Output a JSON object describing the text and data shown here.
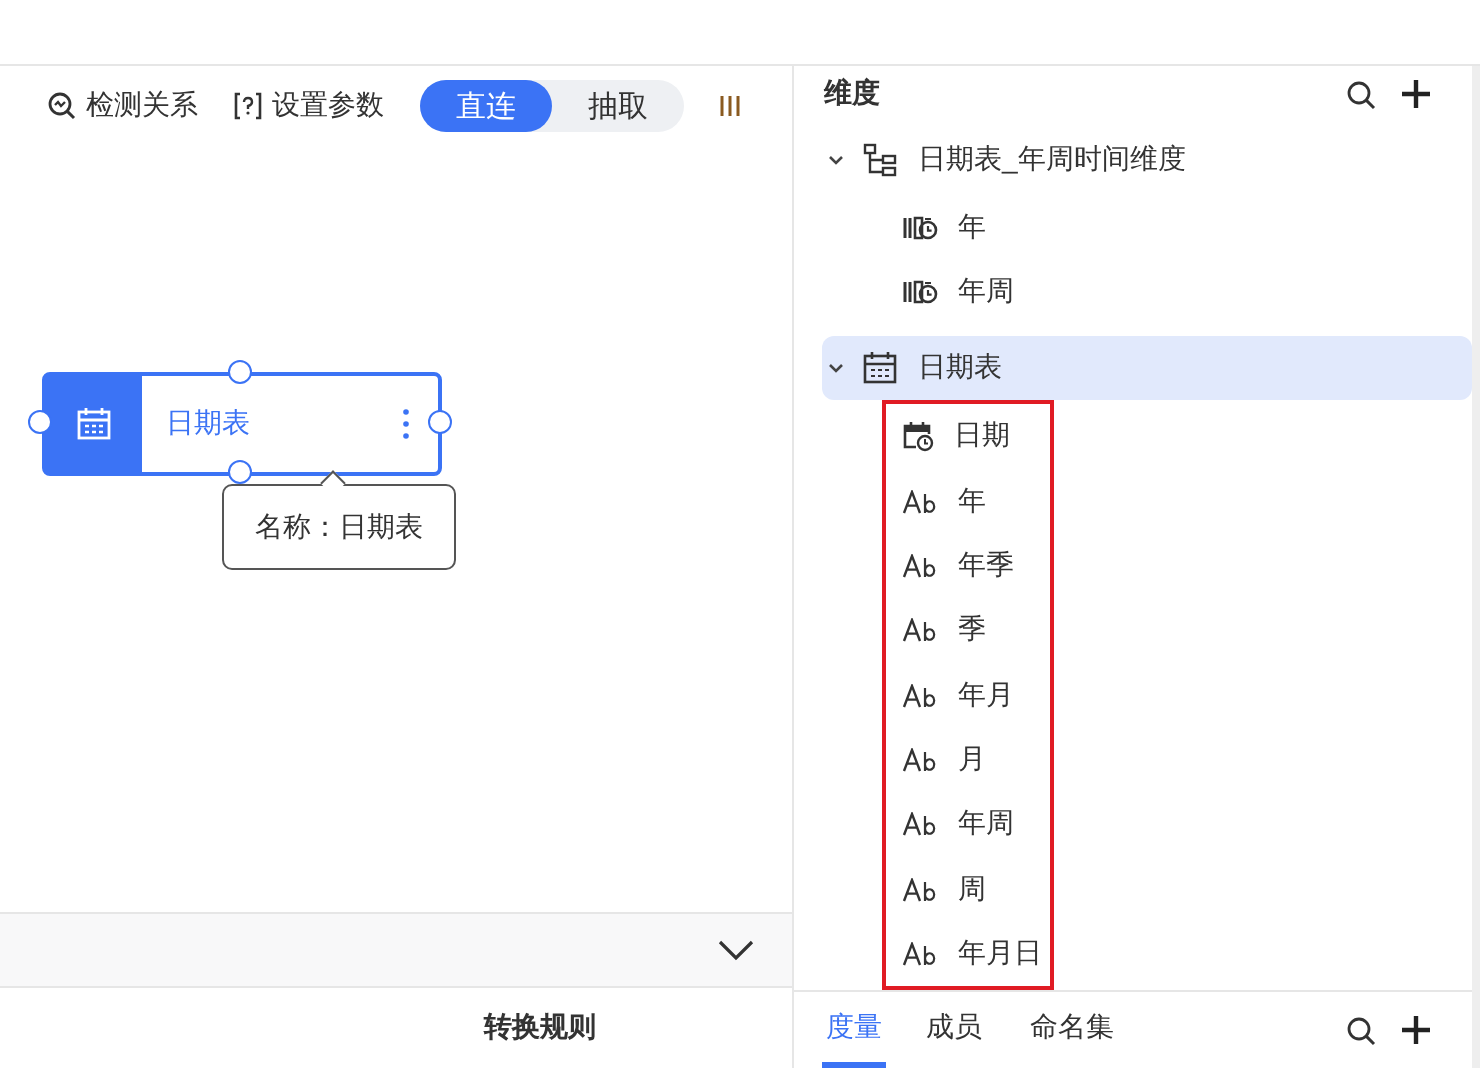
{
  "toolbar": {
    "items": [
      {
        "label": "检测关系",
        "kind": "detect"
      },
      {
        "label": "设置参数",
        "kind": "params"
      }
    ],
    "mode_toggle": [
      {
        "label": "直连",
        "selected": true
      },
      {
        "label": "抽取",
        "selected": false
      }
    ]
  },
  "canvas": {
    "node": {
      "label": "日期表",
      "tooltip": "名称：日期表"
    }
  },
  "bottom_panel": {
    "expanded": false,
    "tab": "转换规则"
  },
  "dimension_panel": {
    "title": "维度",
    "tree": [
      {
        "label": "日期表_年周时间维度",
        "kind": "hierarchy",
        "expanded": true,
        "selected": false,
        "highlighted": false,
        "children": [
          {
            "label": "年",
            "kind": "level"
          },
          {
            "label": "年周",
            "kind": "level"
          }
        ]
      },
      {
        "label": "日期表",
        "kind": "table",
        "expanded": true,
        "selected": true,
        "highlighted": true,
        "children": [
          {
            "label": "日期",
            "kind": "date"
          },
          {
            "label": "年",
            "kind": "text"
          },
          {
            "label": "年季",
            "kind": "text"
          },
          {
            "label": "季",
            "kind": "text"
          },
          {
            "label": "年月",
            "kind": "text"
          },
          {
            "label": "月",
            "kind": "text"
          },
          {
            "label": "年周",
            "kind": "text"
          },
          {
            "label": "周",
            "kind": "text"
          },
          {
            "label": "年月日",
            "kind": "text"
          }
        ]
      }
    ],
    "tabs": [
      {
        "label": "度量",
        "selected": true
      },
      {
        "label": "成员",
        "selected": false
      },
      {
        "label": "命名集",
        "selected": false
      }
    ]
  }
}
